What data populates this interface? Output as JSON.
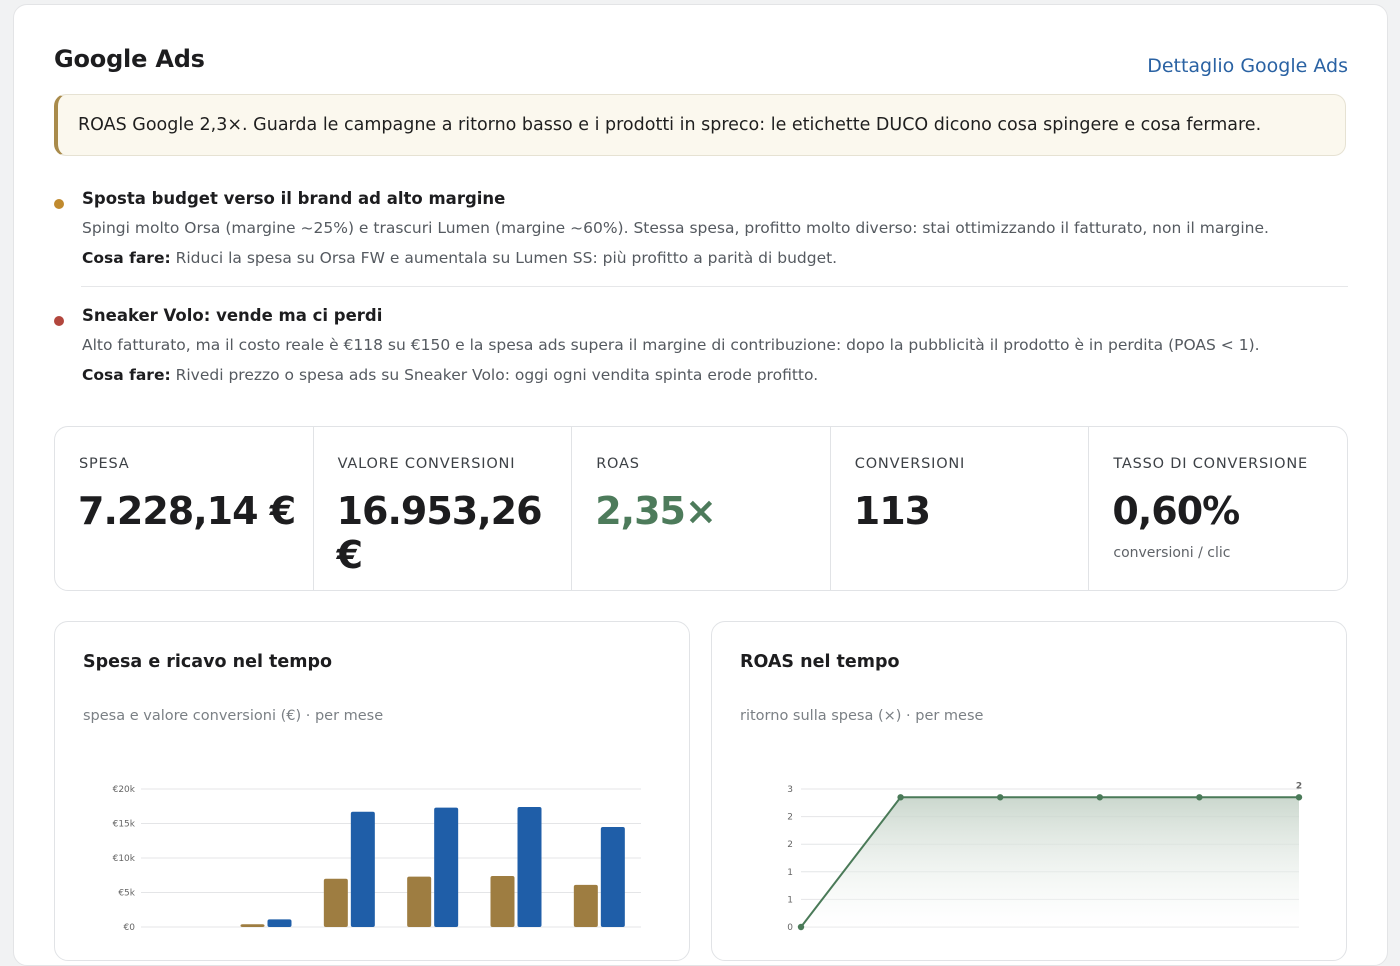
{
  "header": {
    "title": "Google Ads",
    "detail_link": "Dettaglio Google Ads"
  },
  "banner": {
    "text": "ROAS Google 2,3×. Guarda le campagne a ritorno basso e i prodotti in spreco: le etichette DUCO dicono cosa spingere e cosa fermare."
  },
  "insights": [
    {
      "color": "#c08a2e",
      "title": "Sposta budget verso il brand ad alto margine",
      "description": "Spingi molto Orsa (margine ~25%) e trascuri Lumen (margine ~60%). Stessa spesa, profitto molto diverso: stai ottimizzando il fatturato, non il margine.",
      "action_label": "Cosa fare:",
      "action_text": "Riduci la spesa su Orsa FW e aumentala su Lumen SS: più profitto a parità di budget."
    },
    {
      "color": "#b2463d",
      "title": "Sneaker Volo: vende ma ci perdi",
      "description": "Alto fatturato, ma il costo reale è €118 su €150 e la spesa ads supera il margine di contribuzione: dopo la pubblicità il prodotto è in perdita (POAS < 1).",
      "action_label": "Cosa fare:",
      "action_text": "Rivedi prezzo o spesa ads su Sneaker Volo: oggi ogni vendita spinta erode profitto."
    }
  ],
  "kpis": [
    {
      "label": "SPESA",
      "value": "7.228,14 €",
      "sub": ""
    },
    {
      "label": "VALORE CONVERSIONI",
      "value": "16.953,26 €",
      "sub": ""
    },
    {
      "label": "ROAS",
      "value": "2,35×",
      "sub": ""
    },
    {
      "label": "CONVERSIONI",
      "value": "113",
      "sub": ""
    },
    {
      "label": "TASSO DI CONVERSIONE",
      "value": "0,60%",
      "sub": "conversioni / clic"
    }
  ],
  "colors": {
    "accent_link": "#2a62a3",
    "roas_green": "#4d7b5b",
    "spend_bar": "#9e7d41",
    "revenue_bar": "#1f5ea8",
    "roas_line": "#4a7a58"
  },
  "charts": {
    "spend_revenue": {
      "title": "Spesa e ricavo nel tempo",
      "subtitle": "spesa e valore conversioni (€) · per mese"
    },
    "roas": {
      "title": "ROAS nel tempo",
      "subtitle": "ritorno sulla spesa (×) · per mese"
    }
  },
  "chart_data": [
    {
      "type": "bar",
      "title": "Spesa e ricavo nel tempo",
      "subtitle": "spesa e valore conversioni (€) · per mese",
      "y_ticks": [
        "€0",
        "€5k",
        "€10k",
        "€15k",
        "€20k"
      ],
      "ylim": [
        0,
        20000
      ],
      "categories": [
        "",
        "",
        "",
        "",
        "",
        ""
      ],
      "series": [
        {
          "color": "#9e7d41",
          "values": [
            0,
            400,
            7000,
            7300,
            7400,
            6100
          ]
        },
        {
          "color": "#1f5ea8",
          "values": [
            0,
            1100,
            16700,
            17300,
            17400,
            14500
          ]
        }
      ],
      "grid": true,
      "legend": "none"
    },
    {
      "type": "area",
      "title": "ROAS nel tempo",
      "subtitle": "ritorno sulla spesa (×) · per mese",
      "y_ticks": [
        "0",
        "1",
        "1",
        "2",
        "2",
        "3"
      ],
      "ylim": [
        0,
        2.5
      ],
      "x": [
        0,
        1,
        2,
        3,
        4,
        5
      ],
      "series": [
        {
          "color": "#4a7a58",
          "values": [
            0,
            2.35,
            2.35,
            2.35,
            2.35,
            2.35
          ]
        }
      ],
      "end_label": "2",
      "grid": true,
      "legend": "none"
    }
  ]
}
